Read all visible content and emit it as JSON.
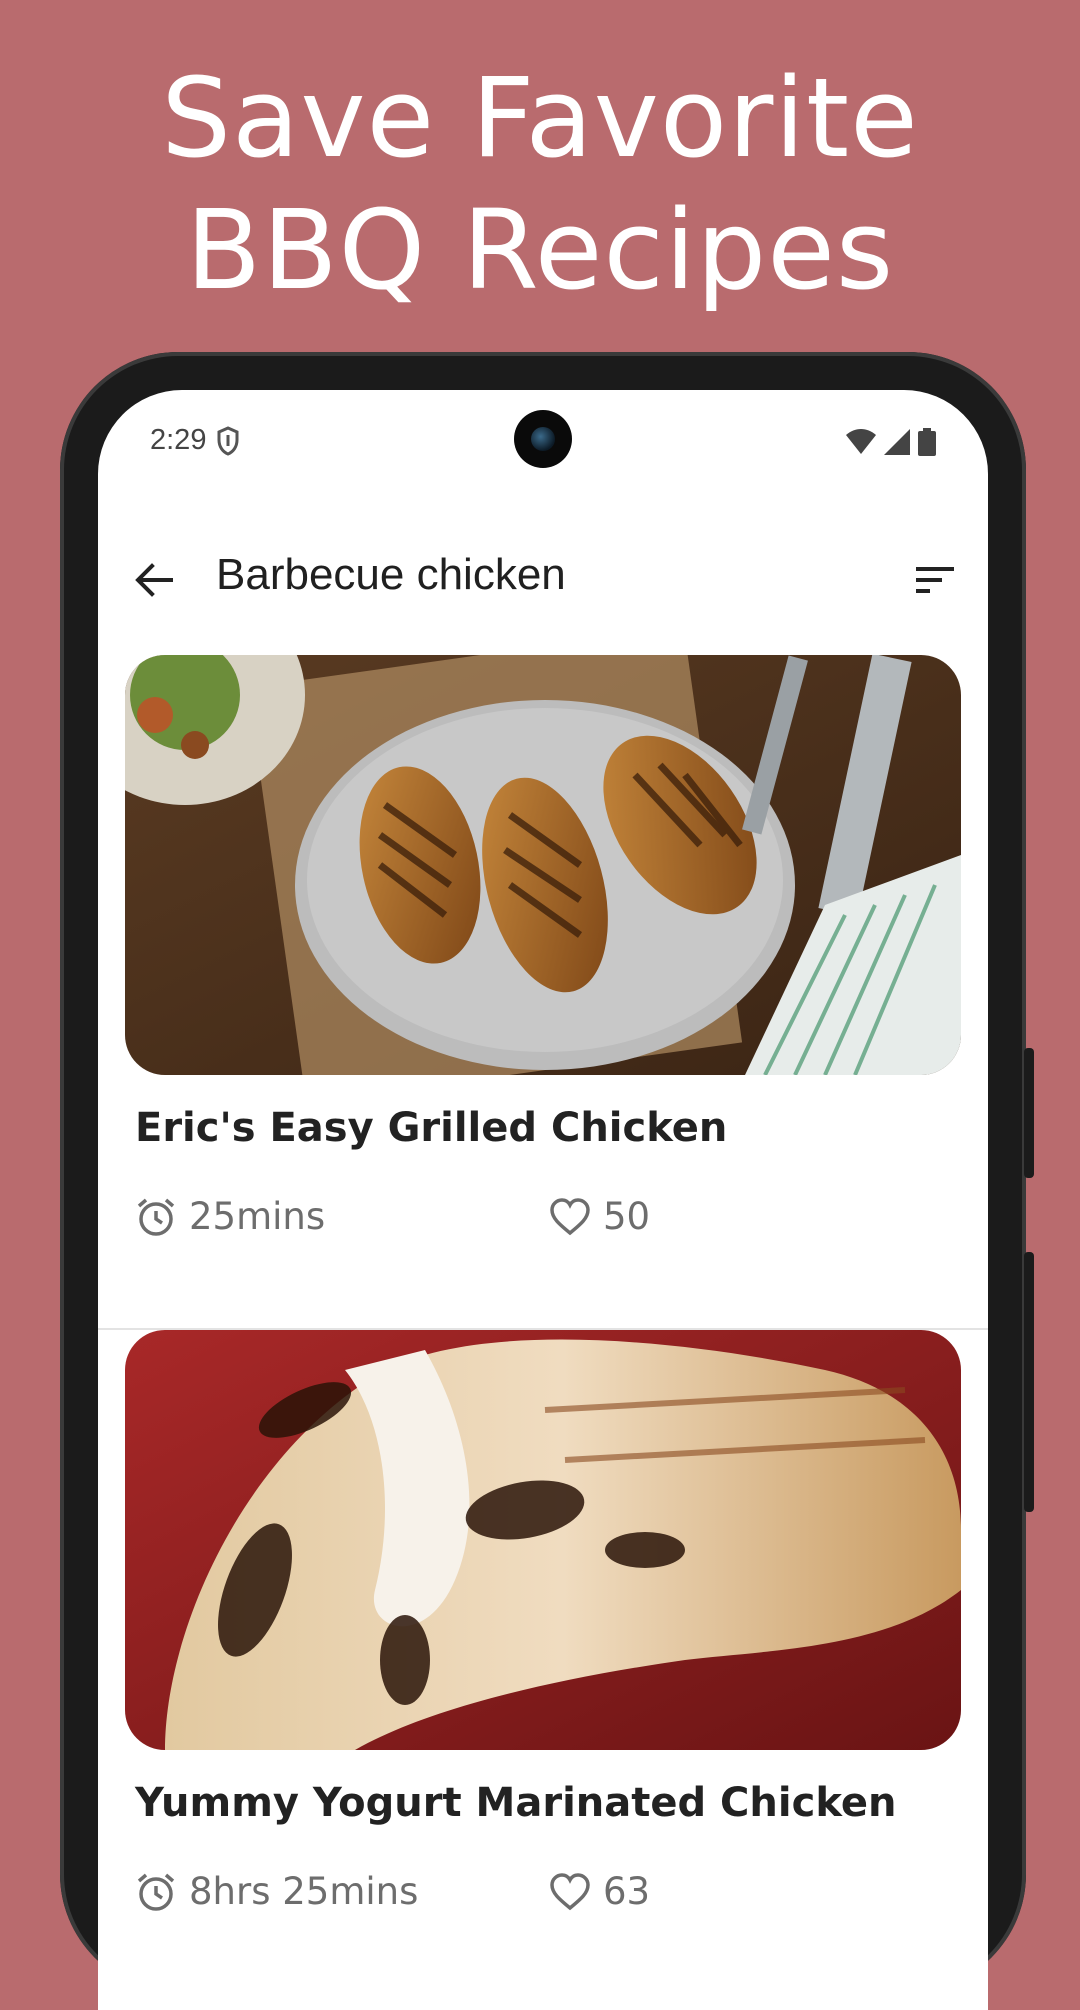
{
  "headline": {
    "line1": "Save Favorite",
    "line2": "BBQ Recipes"
  },
  "status": {
    "time": "2:29"
  },
  "appbar": {
    "title": "Barbecue chicken"
  },
  "recipes": [
    {
      "title": "Eric's Easy Grilled Chicken",
      "time": "25mins",
      "likes": "50"
    },
    {
      "title": "Yummy Yogurt Marinated Chicken",
      "time": "8hrs 25mins",
      "likes": "63"
    }
  ],
  "colors": {
    "background": "#b96b6e",
    "phone_frame": "#1b1b1b",
    "screen": "#ffffff"
  },
  "icons": [
    "shield-icon",
    "wifi-icon",
    "cellular-icon",
    "battery-icon",
    "back-arrow-icon",
    "sort-icon",
    "alarm-clock-icon",
    "heart-icon"
  ]
}
